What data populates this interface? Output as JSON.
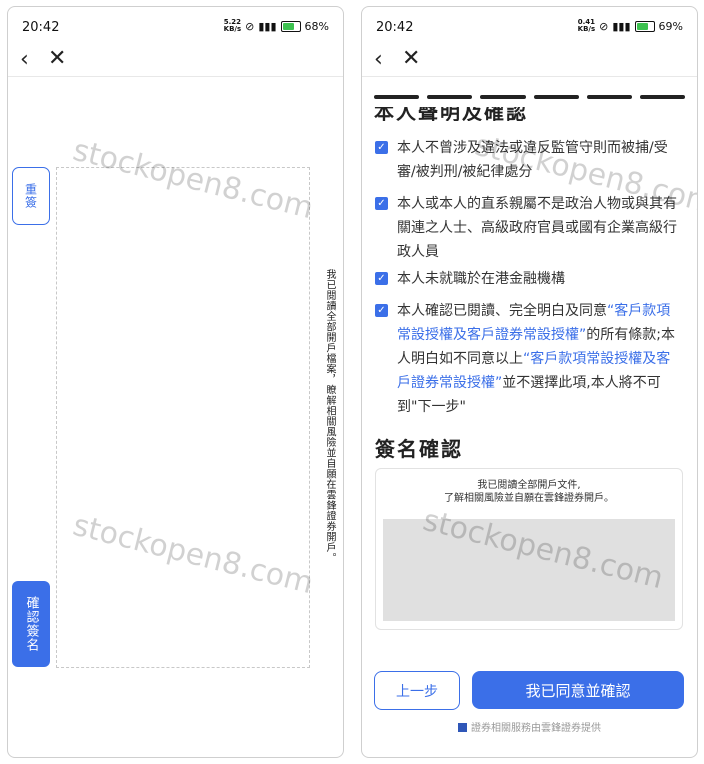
{
  "left_screen": {
    "status": {
      "time": "20:42",
      "speed_value": "5.22",
      "speed_unit": "KB/s",
      "battery": "68%"
    },
    "resign_label": "重簽",
    "confirm_sign_label": "確認簽名",
    "vertical_statement": "我已閱讀全部開戶檔案，瞭解相關風險並自願在雲鋒證券開戶。",
    "watermark": "stockopen8.com"
  },
  "right_screen": {
    "status": {
      "time": "20:42",
      "speed_value": "0.41",
      "speed_unit": "KB/s",
      "battery": "69%"
    },
    "cut_heading": "本人聲明及確認",
    "items": [
      {
        "text": "本人不曾涉及違法或違反監管守則而被捕/受審/被判刑/被紀律處分"
      },
      {
        "text": "本人或本人的直系親屬不是政治人物或與其有關連之人士、高級政府官員或國有企業高級行政人員"
      },
      {
        "text": "本人未就職於在港金融機構"
      }
    ],
    "item4": {
      "p1": "本人確認已閱讀、完全明白及同意",
      "link1": "“客戶款項常設授權及客戶證券常設授權”",
      "p2": "的所有條款;本人明白如不同意以上",
      "link2": "“客戶款項常設授權及客戶證券常設授權”",
      "p3": "並不選擇此項,本人將不可到\"下一步\""
    },
    "sig_heading": "簽名確認",
    "sig_text_line1": "我已閱讀全部開戶文件,",
    "sig_text_line2": "了解相關風險並自願在雲鋒證券開戶。",
    "prev_button": "上一步",
    "agree_button": "我已同意並確認",
    "footer": "證券相關服務由雲鋒證券提供",
    "watermark": "stockopen8.com"
  },
  "colors": {
    "accent": "#3b6fe8"
  }
}
